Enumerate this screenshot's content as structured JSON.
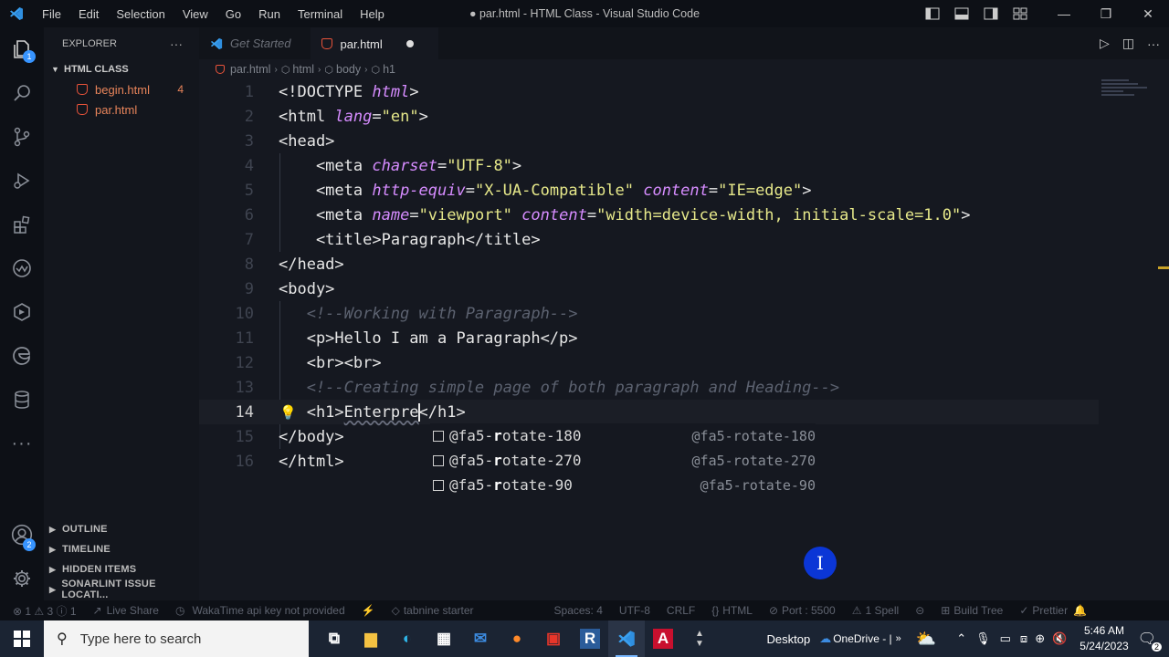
{
  "window": {
    "title": "● par.html - HTML Class - Visual Studio Code",
    "menu": [
      "File",
      "Edit",
      "Selection",
      "View",
      "Go",
      "Run",
      "Terminal",
      "Help"
    ]
  },
  "activity_bar": {
    "explorer_badge": "1",
    "accounts_badge": "2"
  },
  "sidebar": {
    "header": "EXPLORER",
    "folder": "HTML CLASS",
    "files": [
      {
        "name": "begin.html",
        "count": "4"
      },
      {
        "name": "par.html",
        "count": ""
      }
    ],
    "sections": [
      "OUTLINE",
      "TIMELINE",
      "HIDDEN ITEMS",
      "SONARLINT ISSUE LOCATI..."
    ]
  },
  "tabs": [
    {
      "label": "Get Started"
    },
    {
      "label": "par.html"
    }
  ],
  "breadcrumb": [
    "par.html",
    "html",
    "body",
    "h1"
  ],
  "code": {
    "line_numbers": [
      "1",
      "2",
      "3",
      "4",
      "5",
      "6",
      "7",
      "8",
      "9",
      "10",
      "11",
      "12",
      "13",
      "14",
      "15",
      "16"
    ],
    "current_line": "14"
  },
  "suggestions": [
    {
      "label_pre": "@fa5-",
      "label_bold": "r",
      "label_mid": "otate",
      "label_post": "-180",
      "detail": "@fa5-rotate-180"
    },
    {
      "label_pre": "@fa5-",
      "label_bold": "r",
      "label_mid": "otate",
      "label_post": "-270",
      "detail": "@fa5-rotate-270"
    },
    {
      "label_pre": "@fa5-",
      "label_bold": "r",
      "label_mid": "otate",
      "label_post": "-90",
      "detail": "@fa5-rotate-90"
    }
  ],
  "statusbar": {
    "problems": "⊗ 1 ⚠ 3 ⓘ 1",
    "live_share": "Live Share",
    "wakatime": "WakaTime api key not provided",
    "tabnine": "tabnine starter",
    "spaces": "Spaces: 4",
    "encoding": "UTF-8",
    "eol": "CRLF",
    "language": "HTML",
    "port": "Port : 5500",
    "spell": "1 Spell",
    "build_tree": "Build Tree",
    "prettier": "Prettier"
  },
  "taskbar": {
    "search_placeholder": "Type here to search",
    "desktop": "Desktop",
    "onedrive": "OneDrive - |",
    "time": "5:46 AM",
    "date": "5/24/2023",
    "notifications": "2"
  }
}
